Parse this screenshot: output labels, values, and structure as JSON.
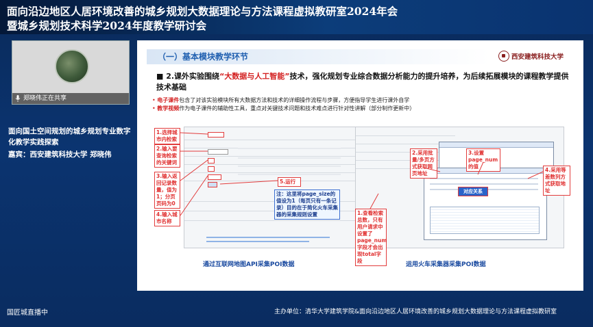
{
  "banner": {
    "line1": "面向沿边地区人居环境改善的城乡规划大数据理论与方法课程虚拟教研室2024年会",
    "line2": "暨城乡规划技术科学2024年度教学研讨会"
  },
  "speaker": {
    "sharing_label": "郑晓伟正在共享",
    "talk_title_line1": "面向国土空间规划的城乡规划专业数字",
    "talk_title_line2": "化教学实践探索",
    "guest_line": "嘉宾：西安建筑科技大学  郑晓伟"
  },
  "footer": {
    "live_label": "国匠城直播中",
    "host_label": "主办单位：清华大学建筑学院&面向沿边地区人居环境改善的城乡规划大数据理论与方法课程虚拟教研室"
  },
  "slide": {
    "section_title": "（一）基本模块教学环节",
    "logo_text": "西安建筑科技大学",
    "headline_pre": "■ 2.课外实验围绕",
    "headline_highlight": "“大数据与人工智能”",
    "headline_post": "技术，强化规划专业综合数据分析能力的提升培养，为后续拓展模块的课程教学提供技术基础",
    "bullet1_key": "电子课件",
    "bullet1_rest": "包含了对该实验模块所有大数据方法和技术的详细操作流程与步骤，方便指导学生进行课外自学",
    "bullet2_key": "教学视频",
    "bullet2_rest": "作为电子课件的辅助性工具，重点对关键技术问题和技术难点进行针对性讲解（部分制作更新中）",
    "left_panel": {
      "callouts": [
        "1.选择城市内检索",
        "2.输入要查询检索的关键词",
        "3.输入返回记录数量，值为1；分页页码为0",
        "4.输入城市名称",
        "5.运行"
      ],
      "note": "注：这里将page_size的值设为1（每页只有一条记录）目的在于简化火车采集器的采集规则设置",
      "caption": "通过互联网地图API采集POI数据"
    },
    "right_panel": {
      "callouts": [
        "1.查看检索总数，只有用户请求中设置了page_num字段才会出现total字段",
        "2.采用批量/多页方式获取网页地址",
        "3.设置page_num的值",
        "4.采用等差数列方式获取地址"
      ],
      "button": "对应关系",
      "caption": "运用火车采集器采集POI数据"
    }
  },
  "colors": {
    "accent_red": "#d32020",
    "title_blue": "#1f5fb0",
    "background_navy": "#0b3470"
  }
}
